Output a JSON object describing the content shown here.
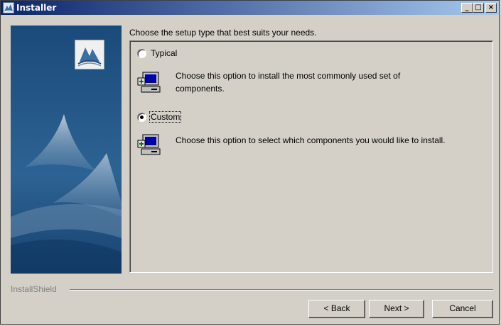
{
  "window": {
    "title": "Installer",
    "controls": {
      "minimize": "_",
      "maximize": "□",
      "close": "×"
    }
  },
  "heading": "Choose the setup type that best suits your needs.",
  "options": [
    {
      "label": "Typical",
      "selected": false,
      "description_line1": "Choose this option to install the most commonly used set of",
      "description_line2": "components.",
      "icon": "computer-setup-icon"
    },
    {
      "label": "Custom",
      "selected": true,
      "description_line1": "Choose this option to select which components you would like to install.",
      "icon": "computer-setup-icon"
    }
  ],
  "footer": {
    "brand": "InstallShield",
    "back_label": "< Back",
    "next_label": "Next >",
    "cancel_label": "Cancel"
  },
  "colors": {
    "title_start": "#0a246a",
    "title_end": "#a6caf0",
    "panel": "#1e4e7c",
    "face": "#d4d0c8"
  }
}
